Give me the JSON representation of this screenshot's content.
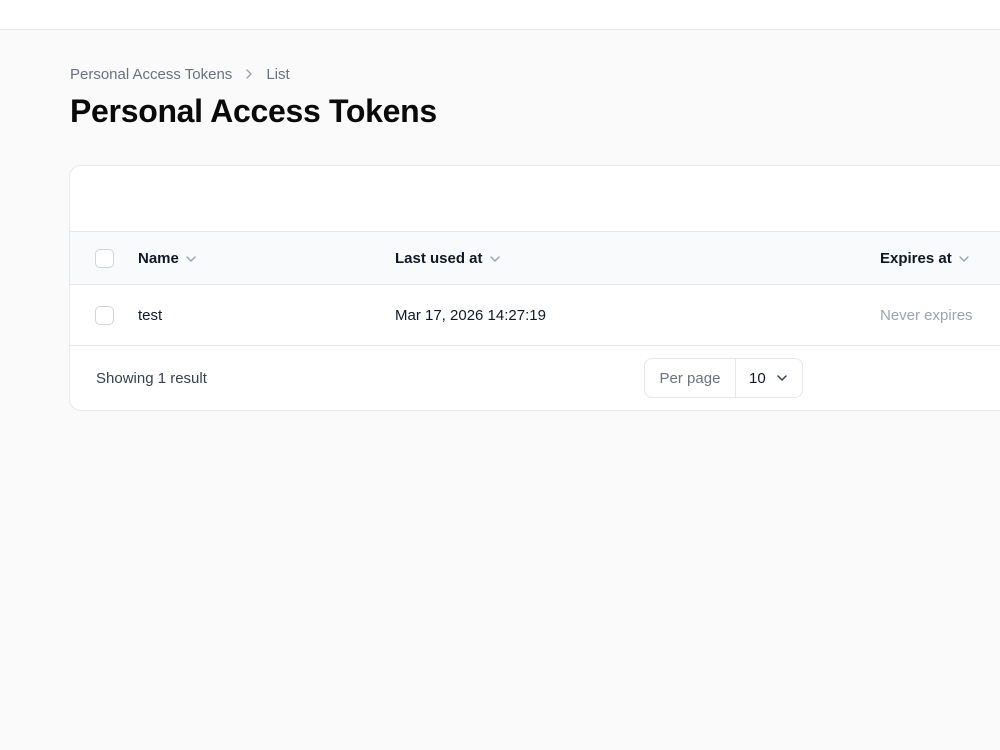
{
  "breadcrumb": {
    "parent": "Personal Access Tokens",
    "current": "List"
  },
  "page": {
    "title": "Personal Access Tokens"
  },
  "table": {
    "columns": {
      "name": "Name",
      "last_used_at": "Last used at",
      "expires_at": "Expires at"
    },
    "rows": [
      {
        "name": "test",
        "last_used_at": "Mar 17, 2026 14:27:19",
        "expires_at": "Never expires"
      }
    ]
  },
  "footer": {
    "showing": "Showing 1 result",
    "per_page_label": "Per page",
    "per_page_value": "10"
  },
  "icons": {
    "breadcrumb_separator": "chevron-right-icon",
    "sort": "chevron-down-icon",
    "select": "chevron-down-icon"
  }
}
